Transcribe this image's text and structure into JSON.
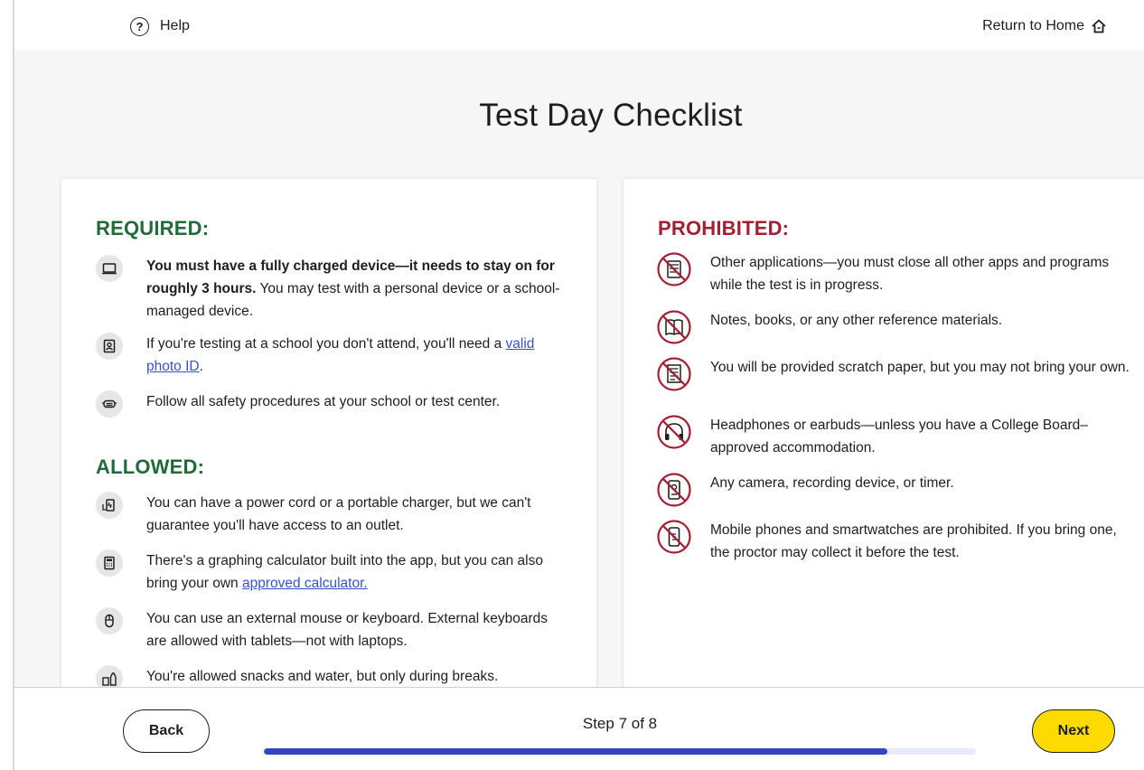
{
  "header": {
    "help_label": "Help",
    "return_home_label": "Return to Home"
  },
  "page_title": "Test Day Checklist",
  "required": {
    "heading": "REQUIRED:",
    "items": [
      {
        "icon": "laptop-icon",
        "bold": "You must have a fully charged device—it needs to stay on for roughly 3 hours.",
        "text": " You may test with a personal device or a school-managed device."
      },
      {
        "icon": "id-card-icon",
        "text": "If you're testing at a school you don't attend, you'll need a ",
        "link": "valid photo ID",
        "after": "."
      },
      {
        "icon": "face-mask-icon",
        "text": "Follow all safety procedures at your school or test center."
      }
    ]
  },
  "allowed": {
    "heading": "ALLOWED:",
    "items": [
      {
        "icon": "charger-icon",
        "text": "You can have a power cord or a portable charger, but we can't guarantee you'll have access to an outlet."
      },
      {
        "icon": "calculator-icon",
        "text": "There's a graphing calculator built into the app, but you can also bring your own ",
        "link": "approved calculator.",
        "after": ""
      },
      {
        "icon": "mouse-icon",
        "text": "You can use an external mouse or keyboard. External keyboards are allowed with tablets—not with laptops."
      },
      {
        "icon": "snacks-icon",
        "text": "You're allowed snacks and water, but only during breaks."
      }
    ]
  },
  "prohibited": {
    "heading": "PROHIBITED:",
    "items": [
      {
        "icon": "no-apps-icon",
        "text": "Other applications—you must close all other apps and programs while the test is in progress."
      },
      {
        "icon": "no-books-icon",
        "text": "Notes, books, or any other reference materials."
      },
      {
        "icon": "no-paper-icon",
        "text": "You will be provided scratch paper, but you may not bring your own."
      },
      {
        "icon": "no-headphones-icon",
        "text": "Headphones or earbuds—unless you have a College Board–approved accommodation."
      },
      {
        "icon": "no-camera-icon",
        "text": "Any camera, recording device, or timer."
      },
      {
        "icon": "no-phone-icon",
        "text": "Mobile phones and smartwatches are prohibited. If you bring one, the proctor may collect it before the test."
      }
    ]
  },
  "footer": {
    "back_label": "Back",
    "step_label": "Step 7 of 8",
    "progress_fraction": 0.875,
    "next_label": "Next"
  },
  "colors": {
    "required_heading": "#1f6b3a",
    "prohibited_heading": "#a41e34",
    "progress_fill": "#3545c0",
    "next_button": "#fedb00"
  }
}
